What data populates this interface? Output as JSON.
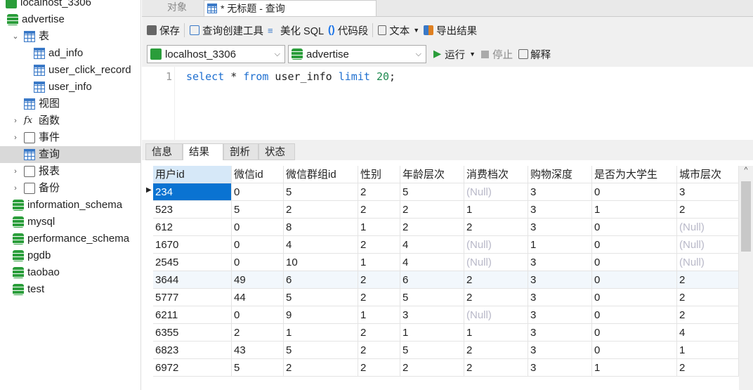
{
  "sidebar": {
    "items": [
      {
        "label": "localhost_3306",
        "icon": "connection-icon",
        "level": 0,
        "chev": ""
      },
      {
        "label": "advertise",
        "icon": "database-icon",
        "level": 0,
        "chev": "v"
      },
      {
        "label": "表",
        "icon": "table-group-icon",
        "level": 1,
        "chev": "v"
      },
      {
        "label": "ad_info",
        "icon": "table-icon",
        "level": 2,
        "chev": ""
      },
      {
        "label": "user_click_record",
        "icon": "table-icon",
        "level": 2,
        "chev": ""
      },
      {
        "label": "user_info",
        "icon": "table-icon",
        "level": 2,
        "chev": ""
      },
      {
        "label": "视图",
        "icon": "view-icon",
        "level": 1,
        "chev": ""
      },
      {
        "label": "函数",
        "icon": "function-icon",
        "level": 1,
        "chev": ">"
      },
      {
        "label": "事件",
        "icon": "event-icon",
        "level": 1,
        "chev": ">"
      },
      {
        "label": "查询",
        "icon": "query-icon",
        "level": 1,
        "chev": "",
        "selected": true
      },
      {
        "label": "报表",
        "icon": "report-icon",
        "level": 1,
        "chev": ">"
      },
      {
        "label": "备份",
        "icon": "backup-icon",
        "level": 1,
        "chev": ">"
      },
      {
        "label": "information_schema",
        "icon": "database-icon",
        "level": 0,
        "chev": ""
      },
      {
        "label": "mysql",
        "icon": "database-icon",
        "level": 0,
        "chev": ""
      },
      {
        "label": "performance_schema",
        "icon": "database-icon",
        "level": 0,
        "chev": ""
      },
      {
        "label": "pgdb",
        "icon": "database-icon",
        "level": 0,
        "chev": ""
      },
      {
        "label": "taobao",
        "icon": "database-icon",
        "level": 0,
        "chev": ""
      },
      {
        "label": "test",
        "icon": "database-icon",
        "level": 0,
        "chev": ""
      }
    ]
  },
  "tabs": {
    "objects": "对象",
    "query": "* 无标题 - 查询"
  },
  "toolbar": {
    "save": "保存",
    "builder": "查询创建工具",
    "beautify": "美化 SQL",
    "snippet": "代码段",
    "text": "文本",
    "export": "导出结果",
    "run": "运行",
    "stop": "停止",
    "explain": "解释"
  },
  "connection": {
    "selected": "localhost_3306"
  },
  "database": {
    "selected": "advertise"
  },
  "editor": {
    "line": "1",
    "kw1": "select",
    "mid": " * ",
    "kw2": "from",
    "mid2": " user_info ",
    "kw3": "limit",
    "num": "20",
    "end": ";"
  },
  "result_tabs": [
    "信息",
    "结果 1",
    "剖析",
    "状态"
  ],
  "grid": {
    "columns": [
      "用户id",
      "微信id",
      "微信群组id",
      "性别",
      "年龄层次",
      "消费档次",
      "购物深度",
      "是否为大学生",
      "城市层次"
    ],
    "rows": [
      [
        "234",
        "0",
        "5",
        "2",
        "5",
        "(Null)",
        "3",
        "0",
        "3"
      ],
      [
        "523",
        "5",
        "2",
        "2",
        "2",
        "1",
        "3",
        "1",
        "2"
      ],
      [
        "612",
        "0",
        "8",
        "1",
        "2",
        "2",
        "3",
        "0",
        "(Null)"
      ],
      [
        "1670",
        "0",
        "4",
        "2",
        "4",
        "(Null)",
        "1",
        "0",
        "(Null)"
      ],
      [
        "2545",
        "0",
        "10",
        "1",
        "4",
        "(Null)",
        "3",
        "0",
        "(Null)"
      ],
      [
        "3644",
        "49",
        "6",
        "2",
        "6",
        "2",
        "3",
        "0",
        "2"
      ],
      [
        "5777",
        "44",
        "5",
        "2",
        "5",
        "2",
        "3",
        "0",
        "2"
      ],
      [
        "6211",
        "0",
        "9",
        "1",
        "3",
        "(Null)",
        "3",
        "0",
        "2"
      ],
      [
        "6355",
        "2",
        "1",
        "2",
        "1",
        "1",
        "3",
        "0",
        "4"
      ],
      [
        "6823",
        "43",
        "5",
        "2",
        "5",
        "2",
        "3",
        "0",
        "1"
      ],
      [
        "6972",
        "5",
        "2",
        "2",
        "2",
        "2",
        "3",
        "1",
        "2"
      ]
    ]
  }
}
